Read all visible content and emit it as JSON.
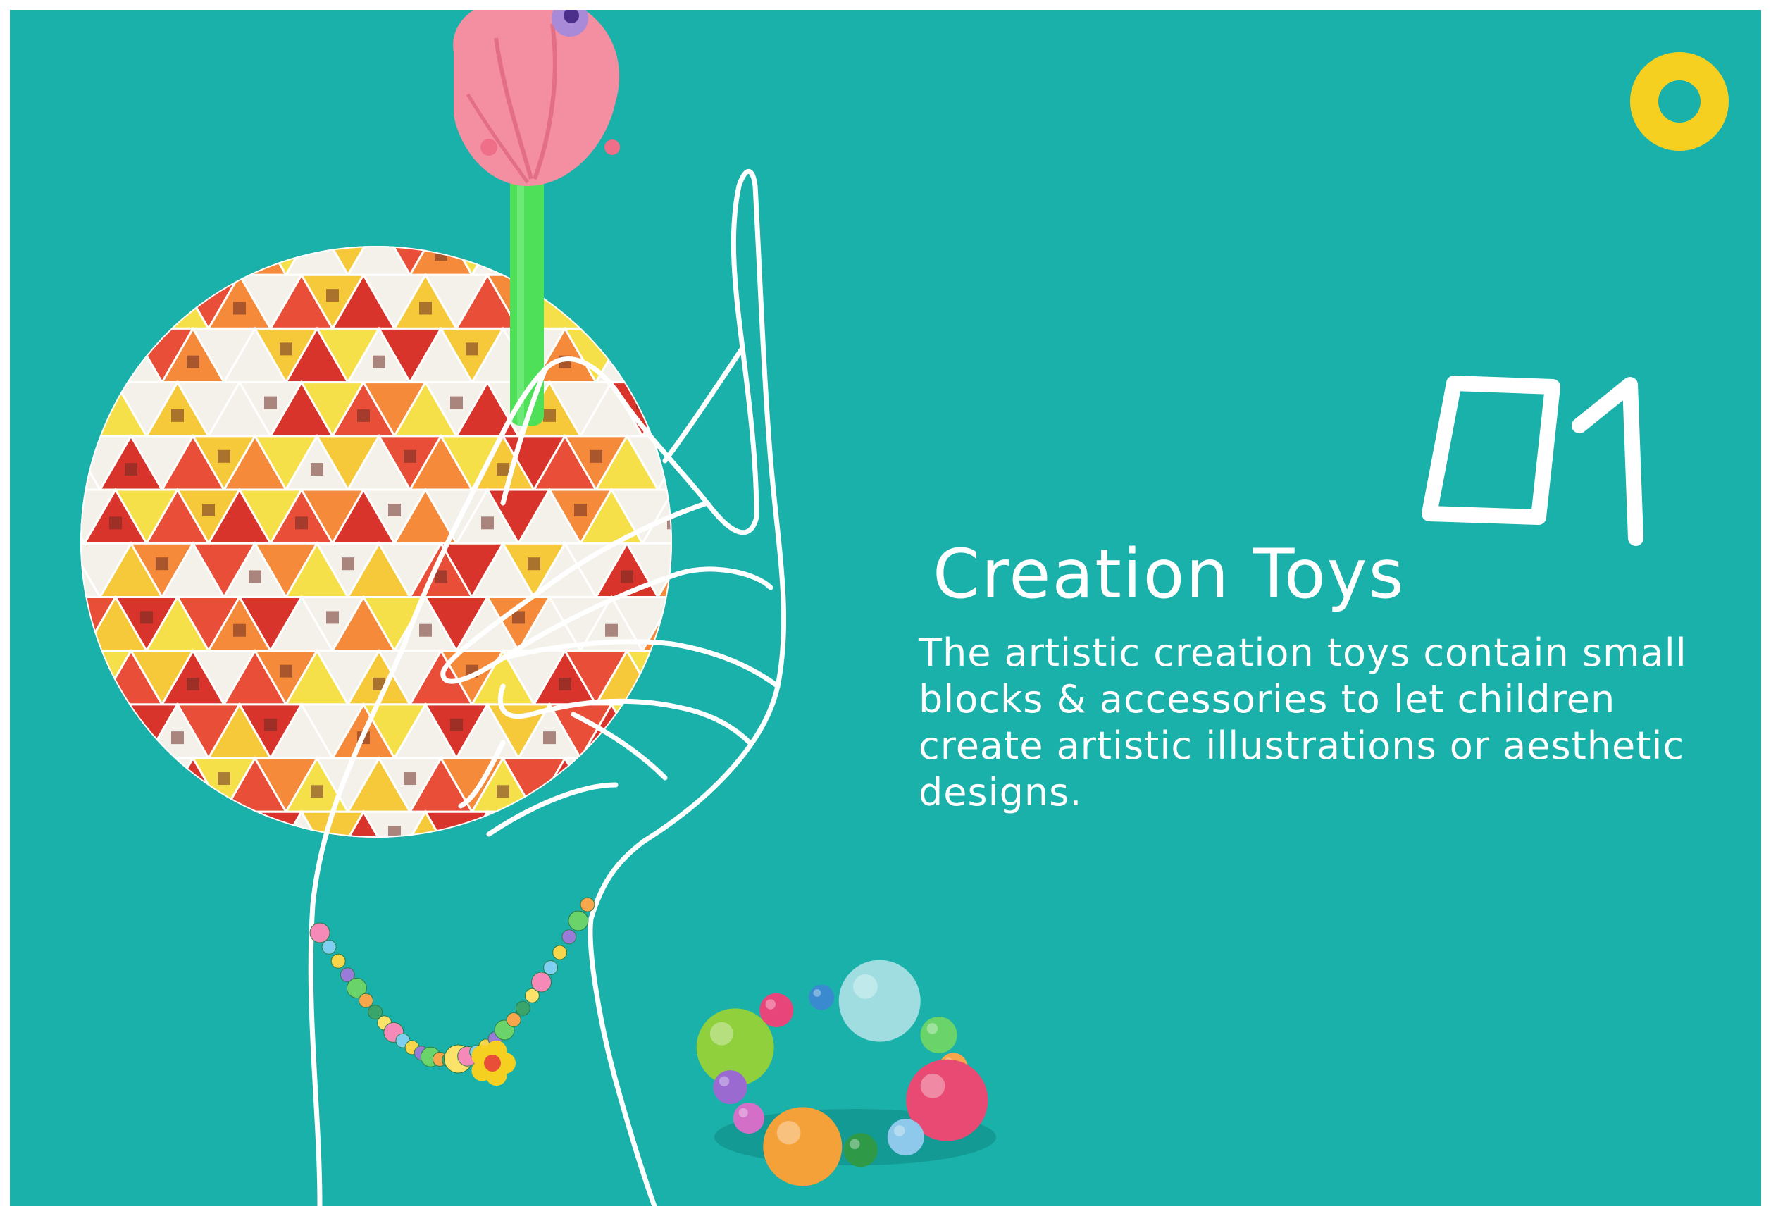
{
  "slide": {
    "number": "01",
    "title": "Creation Toys",
    "description": "The artistic creation toys contain small blocks & accessories to let children create artistic illustrations or aesthetic designs."
  },
  "colors": {
    "background": "#1ab1aa",
    "frame": "#ffffff",
    "accent_ring": "#f6d021",
    "text": "#ffffff"
  },
  "icons": [
    "yellow-ring-icon",
    "mosaic-disc",
    "hand-outline",
    "tulip-pen",
    "bead-bracelet",
    "bead-ring-toy"
  ]
}
